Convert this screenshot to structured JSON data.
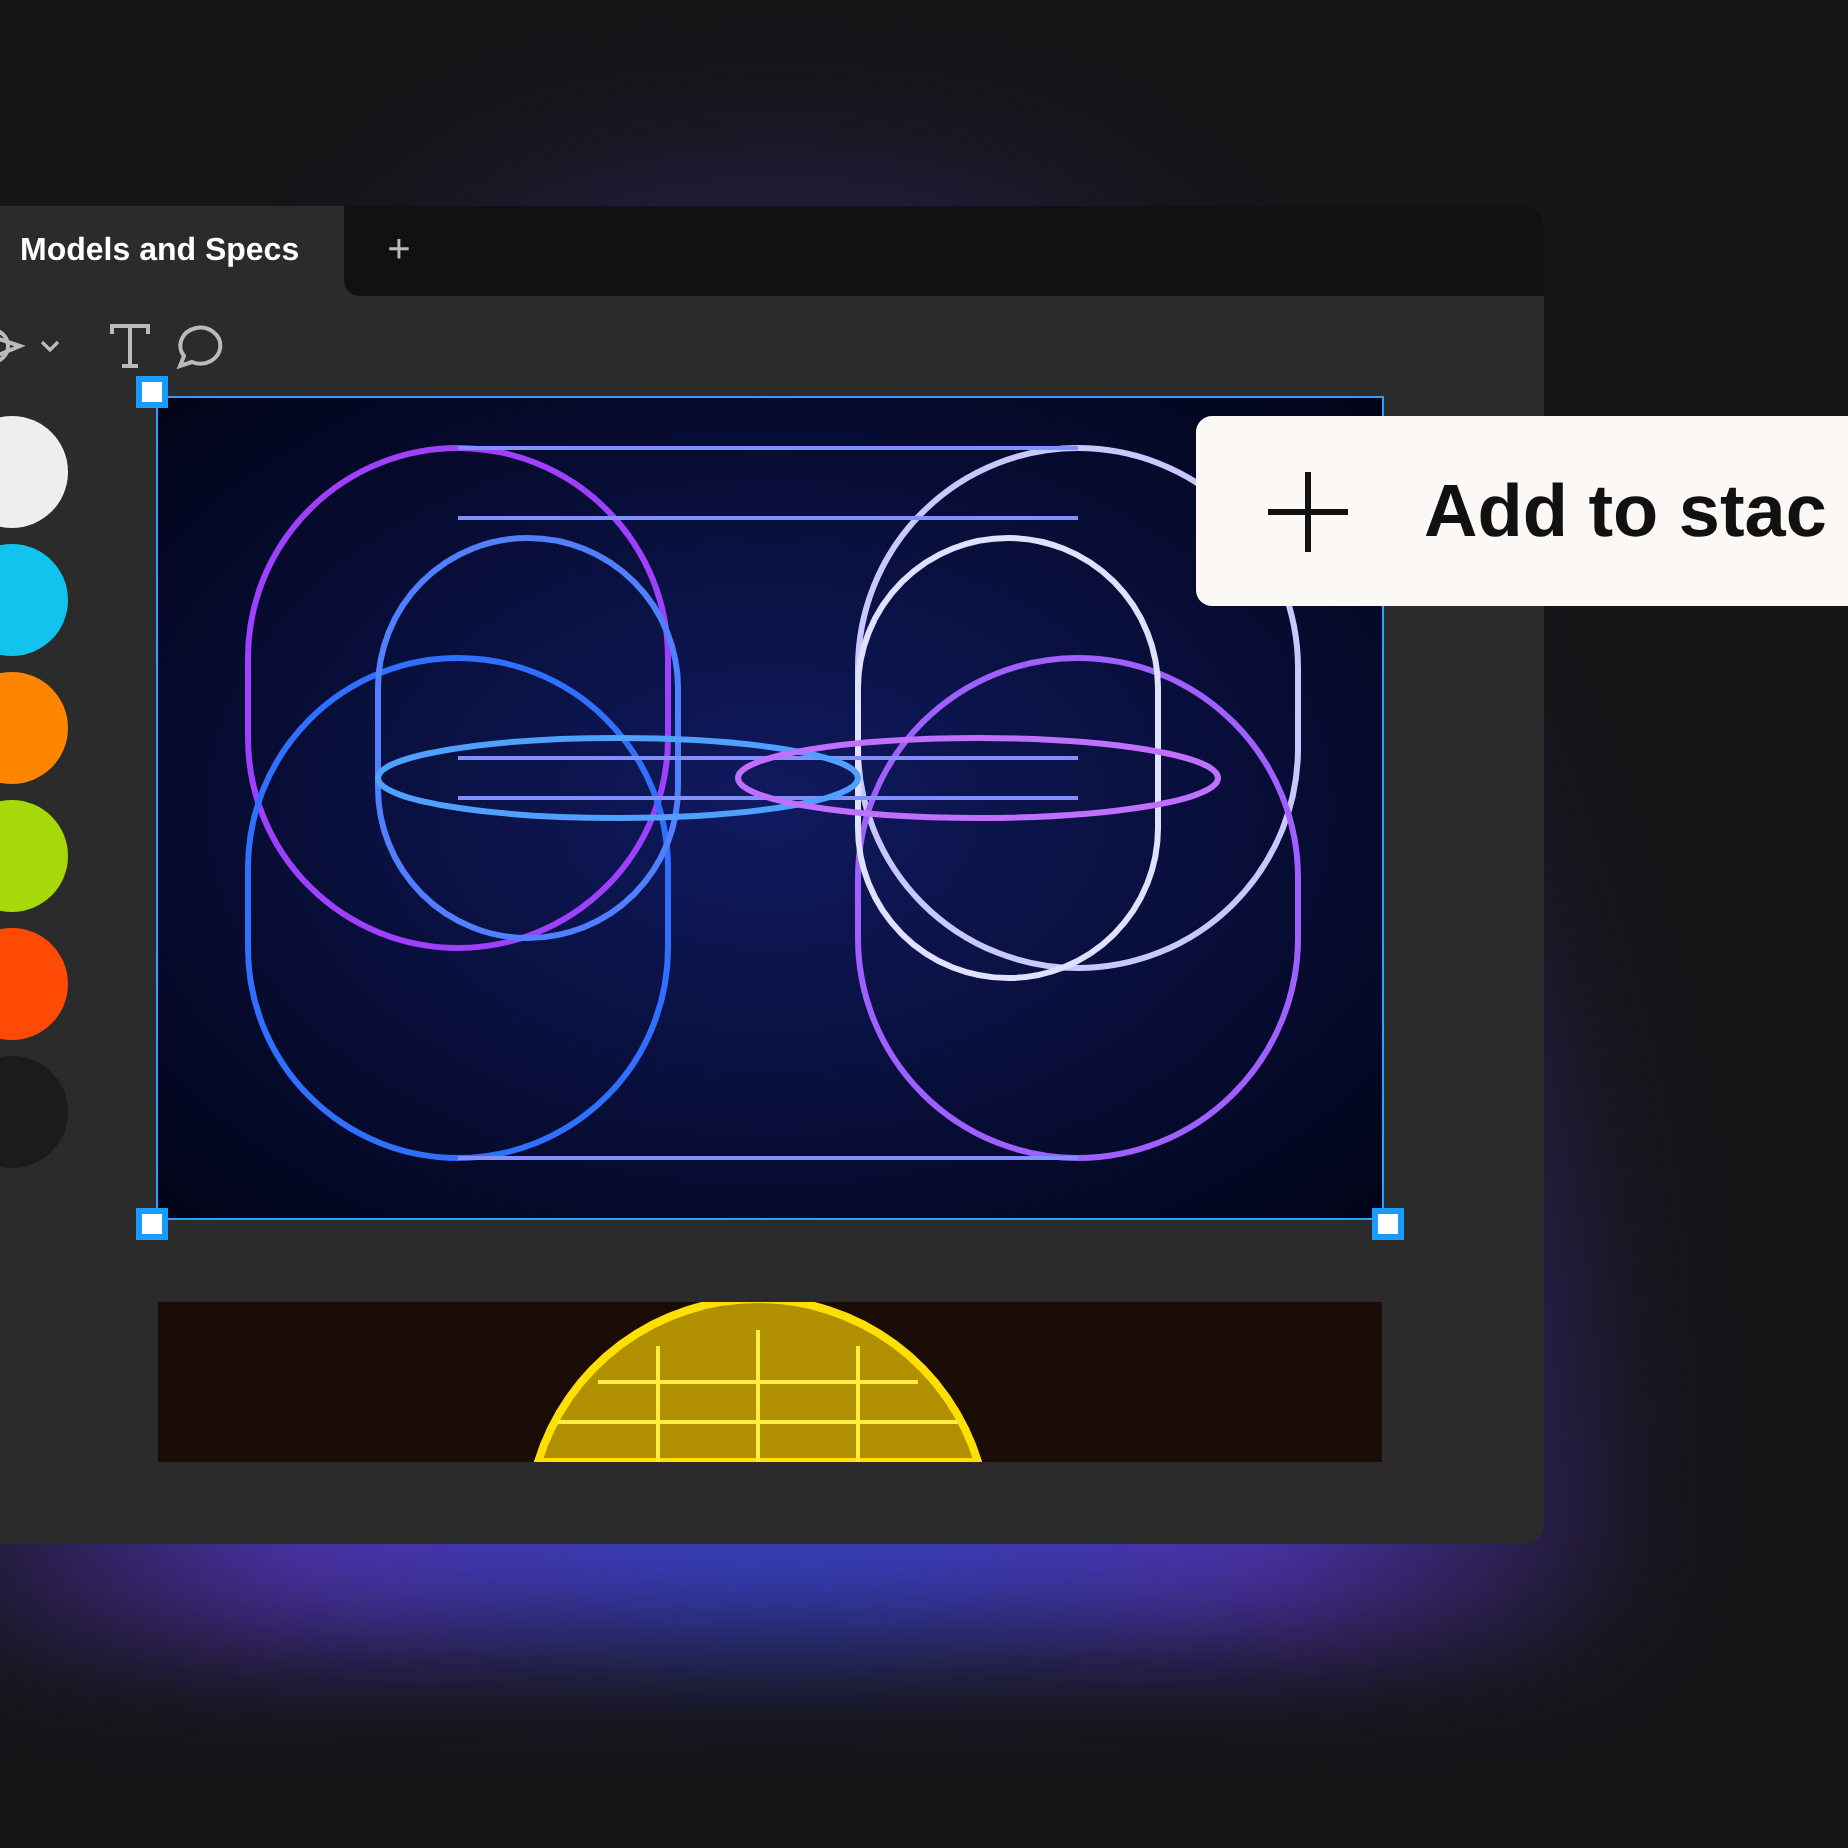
{
  "tabs": [
    {
      "label": "Models and Specs"
    }
  ],
  "new_tab": {
    "label": "+"
  },
  "toolbar": {
    "tools": [
      {
        "kind": "shape"
      },
      {
        "kind": "text"
      },
      {
        "kind": "comment"
      }
    ]
  },
  "swatches": [
    {
      "color": "#eeeeee"
    },
    {
      "color": "#10c4ee"
    },
    {
      "color": "#ff8400"
    },
    {
      "color": "#a6d80a"
    },
    {
      "color": "#ff4a06"
    },
    {
      "color": "#1c1a1a"
    }
  ],
  "canvas": {
    "items": [
      {
        "kind": "cylinders",
        "selected": true
      },
      {
        "kind": "sphere",
        "selected": false
      }
    ]
  },
  "popup": {
    "label": "Add to stac"
  }
}
